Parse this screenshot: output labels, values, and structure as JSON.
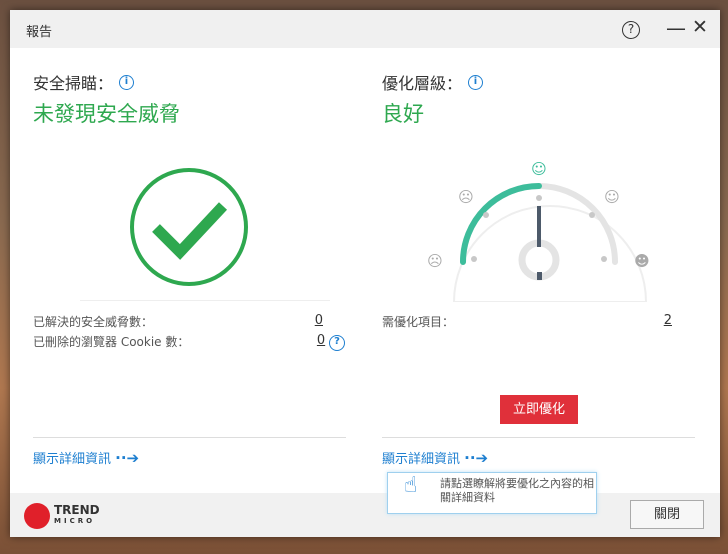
{
  "window": {
    "title": "報告",
    "help_icon": "?",
    "minimize_icon": "—",
    "close_icon": "✕"
  },
  "security": {
    "heading": "安全掃瞄：",
    "status": "未發現安全威脅",
    "status_color": "#2ea84f",
    "rows": [
      {
        "label": "已解決的安全威脅數：",
        "value": "0"
      },
      {
        "label": "已刪除的瀏覽器 Cookie 數：",
        "value": "0"
      }
    ],
    "details_link": "顯示詳細資訊",
    "help_icon": "?"
  },
  "optimization": {
    "heading": "優化層級：",
    "status": "良好",
    "gauge_level_fraction": 0.5,
    "rows": [
      {
        "label": "需優化項目：",
        "value": "2"
      }
    ],
    "optimize_button": "立即優化",
    "details_link": "顯示詳細資訊",
    "tooltip": "請點選瞭解將要優化之內容的相關詳細資料"
  },
  "footer": {
    "logo_top": "TREND",
    "logo_bottom": "MICRO",
    "close_button": "關閉"
  }
}
